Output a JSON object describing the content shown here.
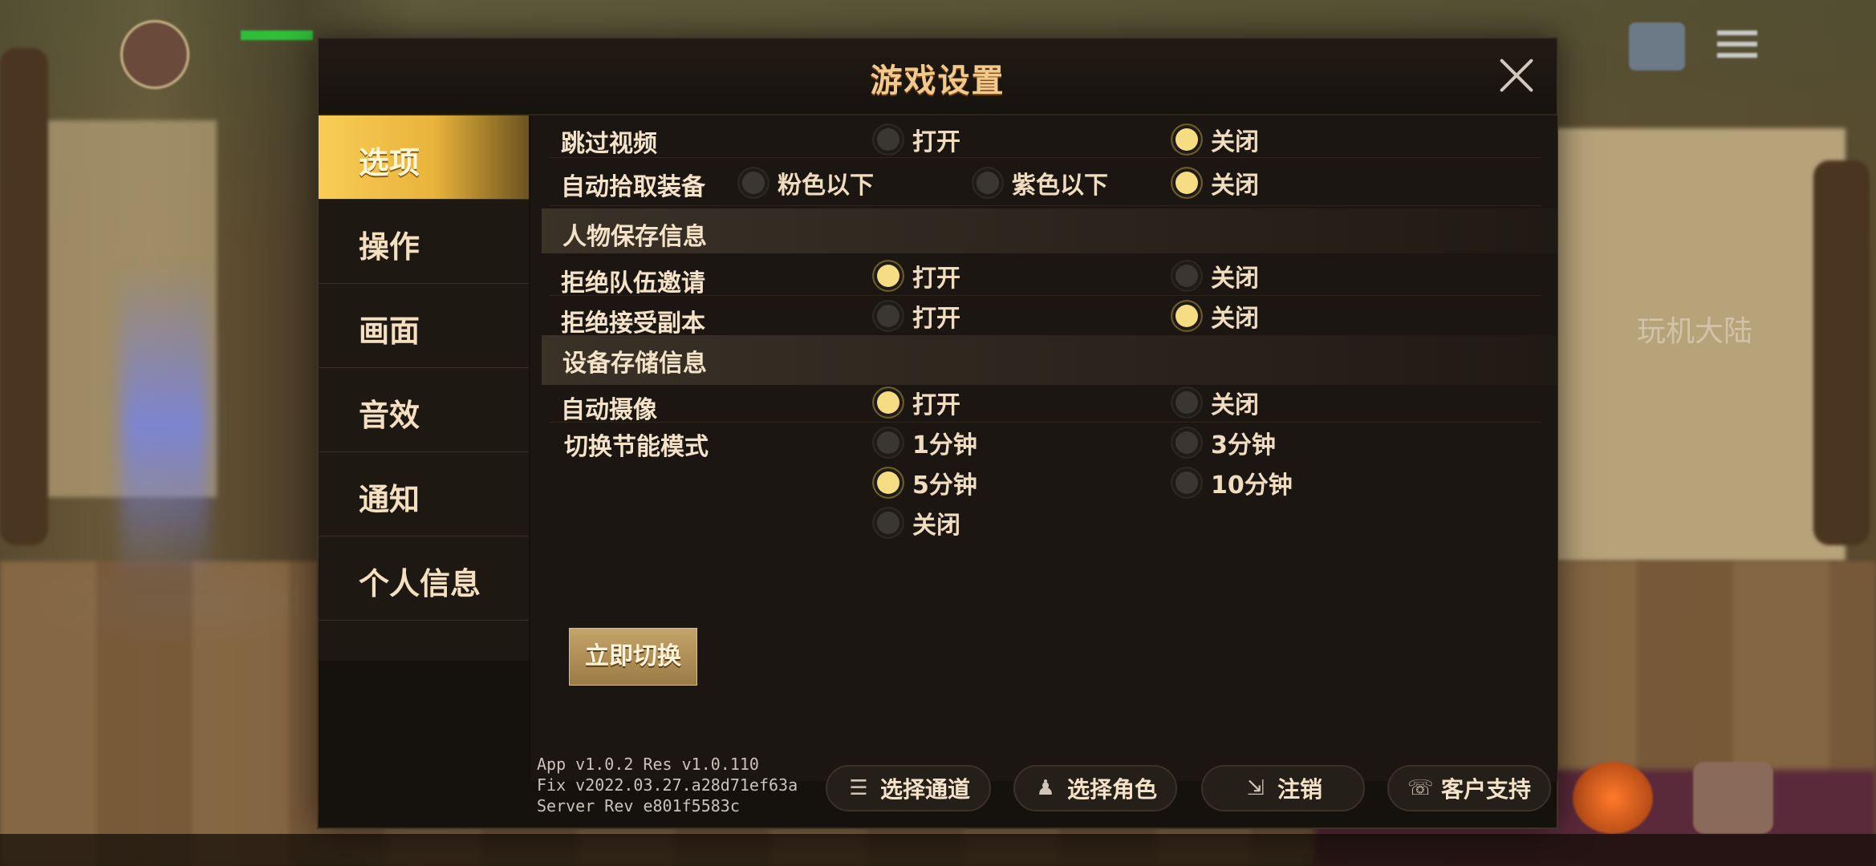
{
  "dialog": {
    "title": "游戏设置"
  },
  "sidebar": {
    "tabs": [
      {
        "label": "选项",
        "active": true
      },
      {
        "label": "操作",
        "active": false
      },
      {
        "label": "画面",
        "active": false
      },
      {
        "label": "音效",
        "active": false
      },
      {
        "label": "通知",
        "active": false
      },
      {
        "label": "个人信息",
        "active": false
      }
    ]
  },
  "settings": {
    "skip_video": {
      "label": "跳过视频",
      "on": "打开",
      "off": "关闭",
      "selected": "关闭"
    },
    "auto_pickup": {
      "label": "自动拾取装备",
      "pink": "粉色以下",
      "purple": "紫色以下",
      "off": "关闭",
      "selected": "关闭"
    },
    "section_character": "人物保存信息",
    "refuse_party": {
      "label": "拒绝队伍邀请",
      "on": "打开",
      "off": "关闭",
      "selected": "打开"
    },
    "refuse_dungeon": {
      "label": "拒绝接受副本",
      "on": "打开",
      "off": "关闭",
      "selected": "关闭"
    },
    "section_device": "设备存储信息",
    "auto_camera": {
      "label": "自动摄像",
      "on": "打开",
      "off": "关闭",
      "selected": "打开"
    },
    "power_save": {
      "label": "切换节能模式",
      "options": [
        "1分钟",
        "3分钟",
        "5分钟",
        "10分钟",
        "关闭"
      ],
      "selected": "5分钟",
      "switch_now": "立即切换"
    }
  },
  "footer": {
    "version_lines": [
      "App v1.0.2 Res v1.0.110",
      "Fix v2022.03.27.a28d71ef63a",
      "Server Rev e801f5583c"
    ],
    "buttons": {
      "select_channel": "选择通道",
      "select_character": "选择角色",
      "logout": "注销",
      "support": "客户支持"
    }
  },
  "watermark": "玩机大陆",
  "colors": {
    "accent": "#f6dd84",
    "tab_active": "#f9cd55",
    "title": "#f2c98a",
    "panel": "#15110d"
  }
}
